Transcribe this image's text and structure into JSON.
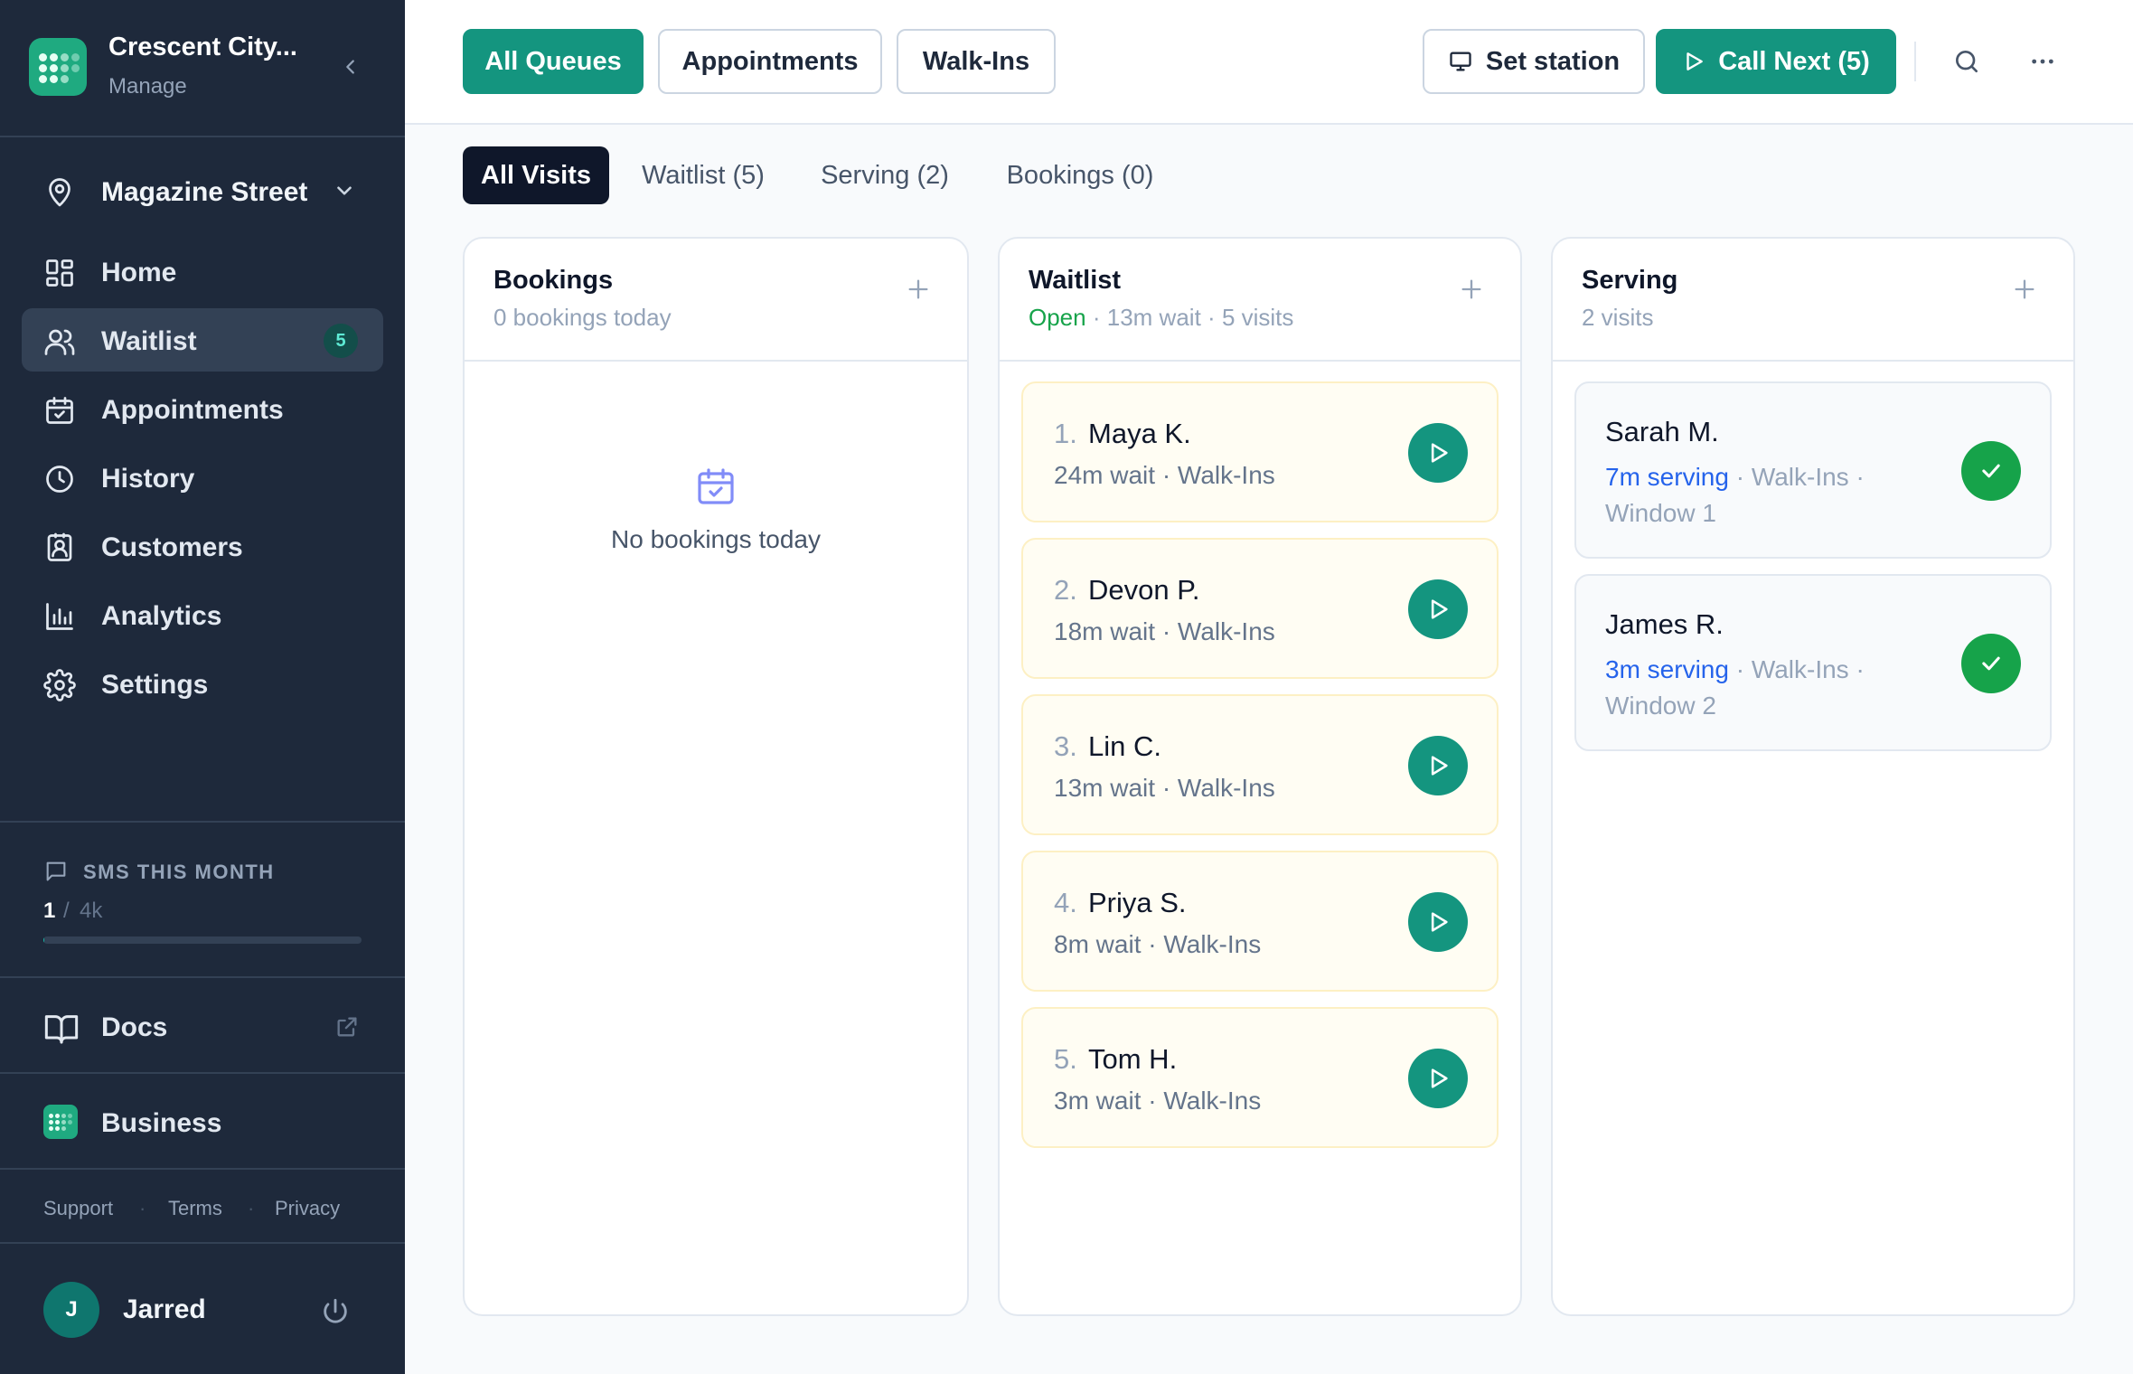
{
  "app": {
    "brand_name": "Crescent City...",
    "brand_sub": "Manage",
    "accent": "#14957f",
    "sidebar_bg": "#1e293b"
  },
  "sidebar": {
    "location": "Magazine Street",
    "nav": [
      {
        "label": "Home",
        "icon": "home-grid-icon",
        "active": false
      },
      {
        "label": "Waitlist",
        "icon": "users-icon",
        "active": true,
        "badge": "5"
      },
      {
        "label": "Appointments",
        "icon": "calendar-check-icon",
        "active": false
      },
      {
        "label": "History",
        "icon": "clock-icon",
        "active": false
      },
      {
        "label": "Customers",
        "icon": "contact-card-icon",
        "active": false
      },
      {
        "label": "Analytics",
        "icon": "bar-chart-icon",
        "active": false
      },
      {
        "label": "Settings",
        "icon": "gear-icon",
        "active": false
      }
    ],
    "sms": {
      "title": "SMS THIS MONTH",
      "used": "1",
      "separator": "/",
      "limit": "4k",
      "usage_fraction": 0.00025
    },
    "docs_label": "Docs",
    "business_label": "Business",
    "footer_links": [
      "Support",
      "Terms",
      "Privacy"
    ],
    "footer_separator": "·",
    "user": {
      "initial": "J",
      "name": "Jarred"
    }
  },
  "topbar": {
    "queues": [
      "All Queues",
      "Appointments",
      "Walk-Ins"
    ],
    "active_queue": "All Queues",
    "set_station_label": "Set station",
    "call_next_label": "Call Next (5)"
  },
  "filters": {
    "tabs": [
      "All Visits",
      "Waitlist (5)",
      "Serving (2)",
      "Bookings (0)"
    ],
    "active": "All Visits"
  },
  "columns": {
    "bookings": {
      "title": "Bookings",
      "subtitle": "0 bookings today",
      "empty_text": "No bookings today"
    },
    "waitlist": {
      "title": "Waitlist",
      "status": "Open",
      "status_color": "#16a34a",
      "separator": "·",
      "wait": "13m wait",
      "visits": "5 visits",
      "entries": [
        {
          "num": "1.",
          "name": "Maya K.",
          "meta": "24m wait · Walk-Ins"
        },
        {
          "num": "2.",
          "name": "Devon P.",
          "meta": "18m wait · Walk-Ins"
        },
        {
          "num": "3.",
          "name": "Lin C.",
          "meta": "13m wait · Walk-Ins"
        },
        {
          "num": "4.",
          "name": "Priya S.",
          "meta": "8m wait · Walk-Ins"
        },
        {
          "num": "5.",
          "name": "Tom H.",
          "meta": "3m wait · Walk-Ins"
        }
      ]
    },
    "serving": {
      "title": "Serving",
      "subtitle": "2 visits",
      "entries": [
        {
          "name": "Sarah M.",
          "time": "7m serving",
          "meta_rest": " · Walk-Ins · Window 1"
        },
        {
          "name": "James R.",
          "time": "3m serving",
          "meta_rest": " · Walk-Ins · Window 2"
        }
      ]
    }
  }
}
